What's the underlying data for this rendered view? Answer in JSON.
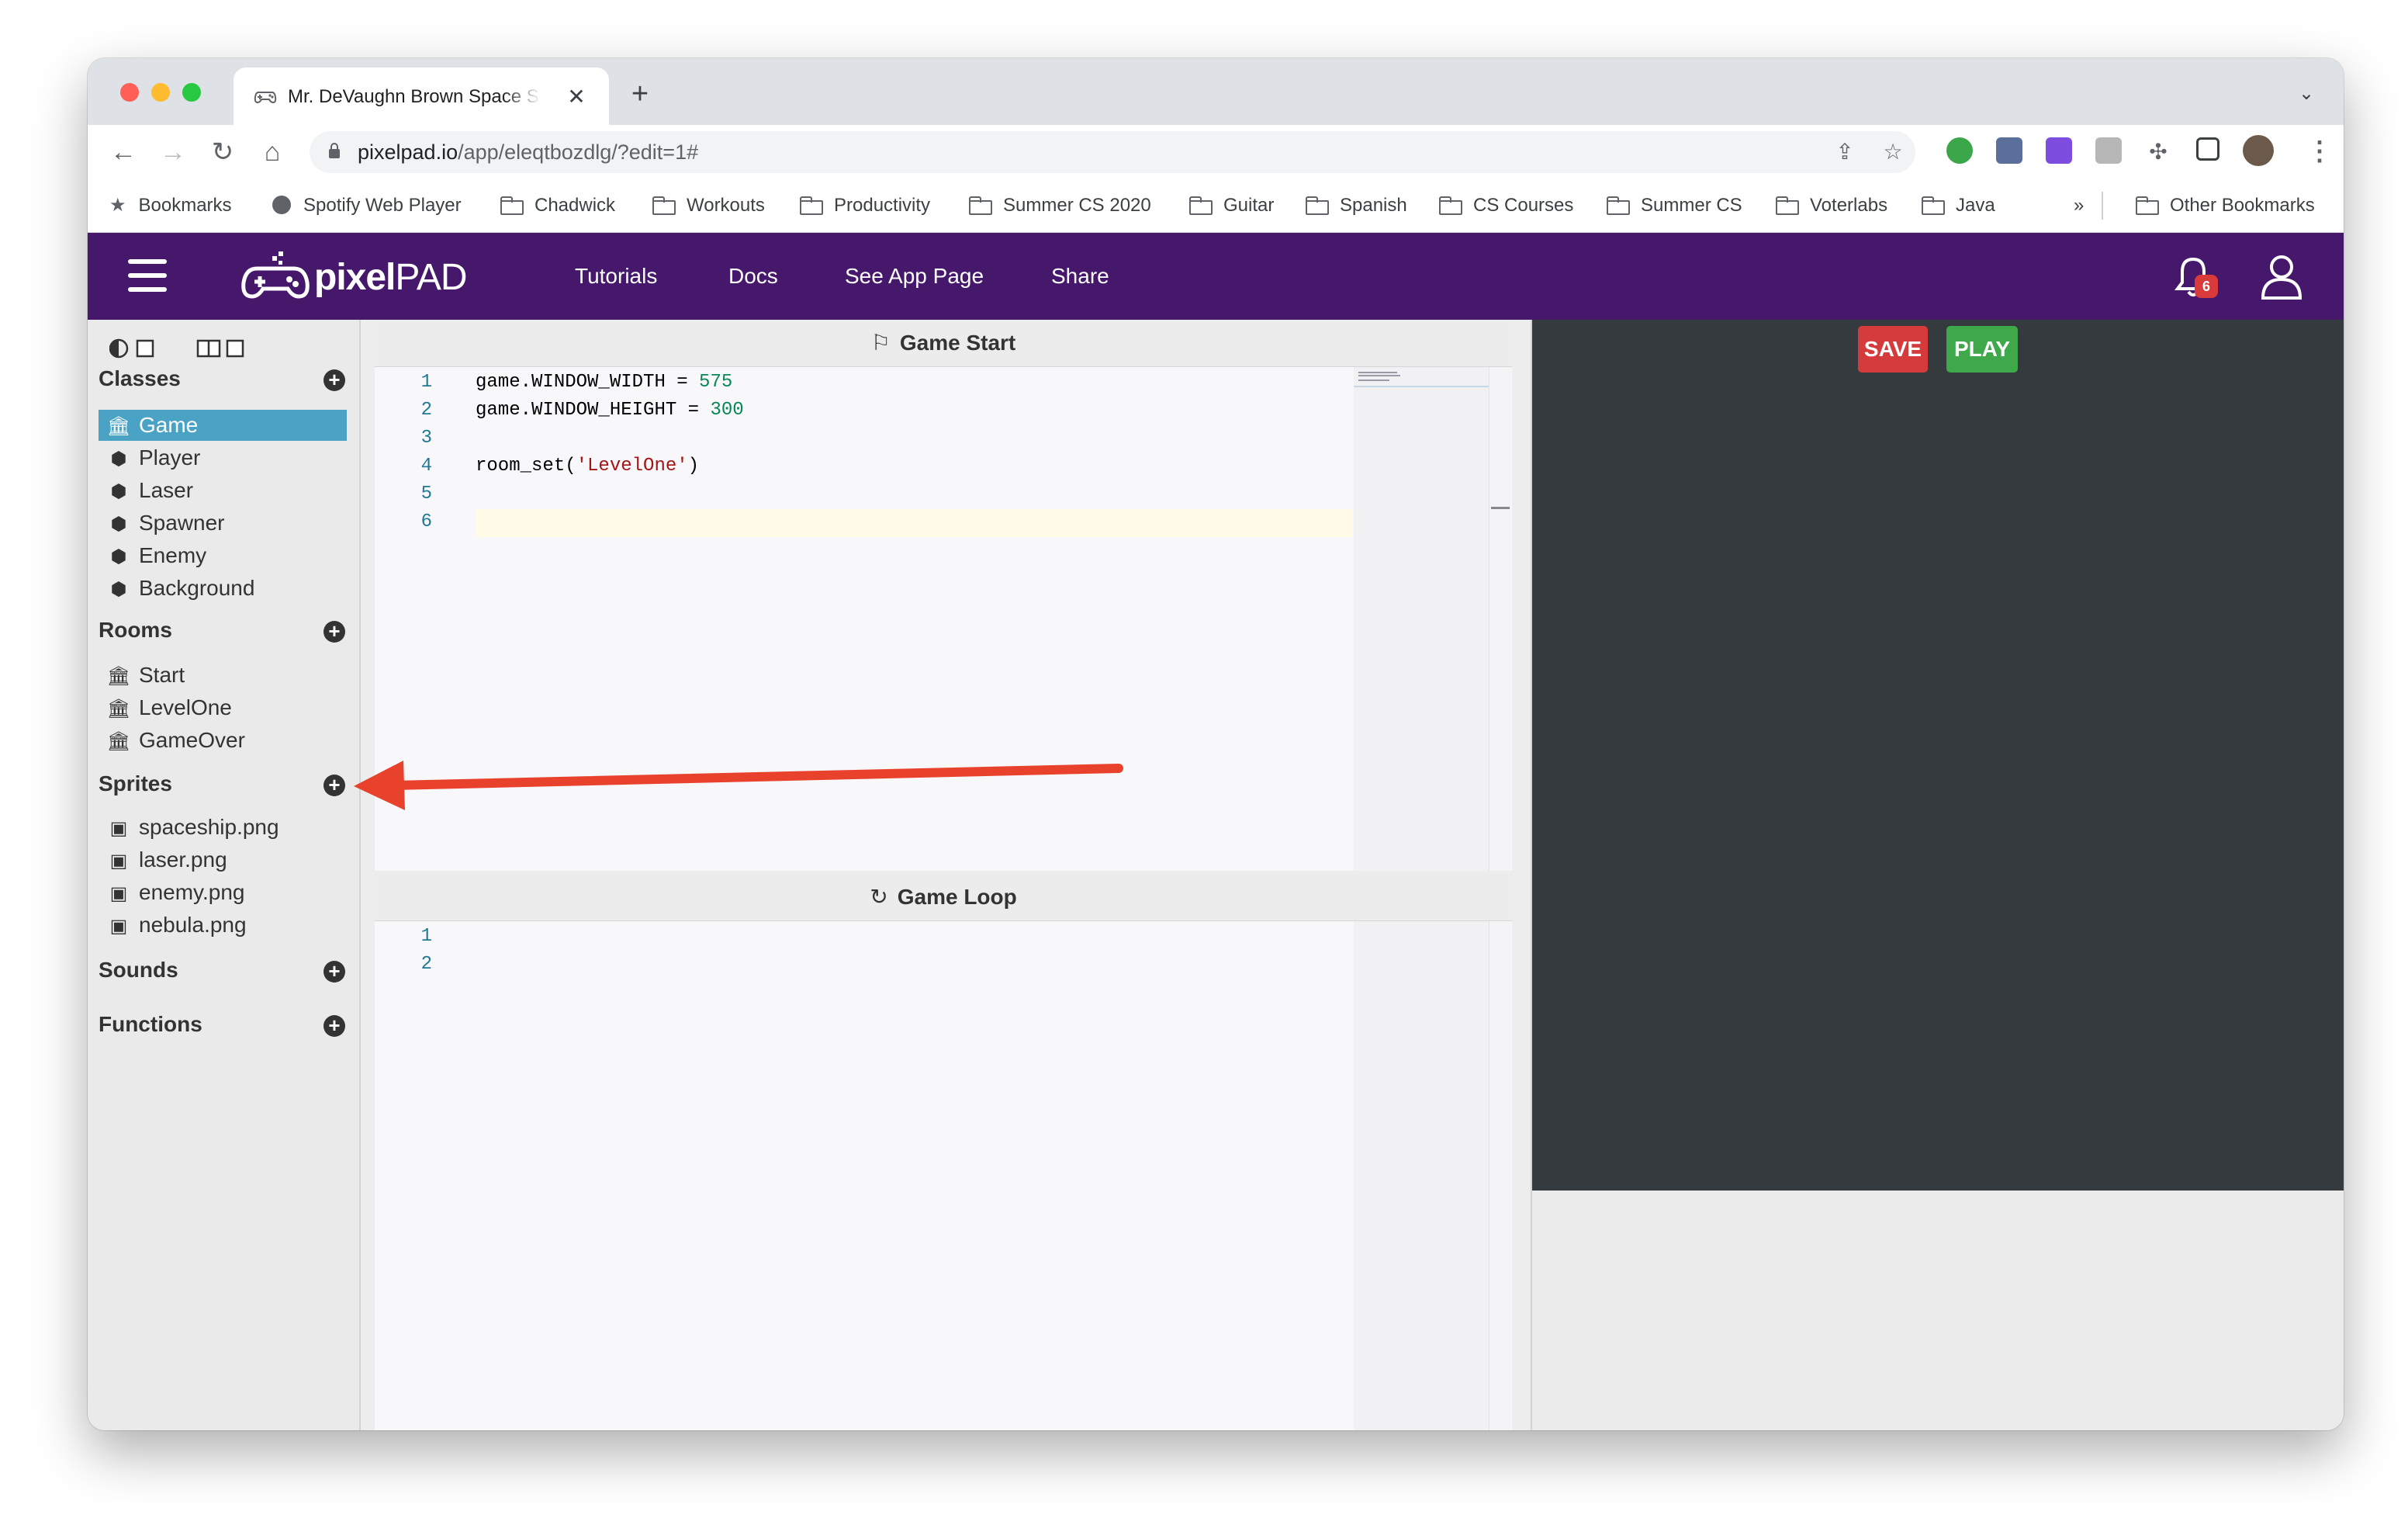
{
  "browser": {
    "tab_title": "Mr. DeVaughn Brown Space Shooter",
    "tab_close": "✕",
    "new_tab": "+",
    "url_host": "pixelpad.io",
    "url_path": "/app/eleqtbozdlg/?edit=1#",
    "bookmarks": [
      "Bookmarks",
      "Spotify Web Player",
      "Chadwick",
      "Workouts",
      "Productivity",
      "Summer CS 2020",
      "Guitar",
      "Spanish",
      "CS Courses",
      "Summer CS",
      "Voterlabs",
      "Java"
    ],
    "more_bookmarks": "»",
    "other_bookmarks": "Other Bookmarks"
  },
  "header": {
    "logo_main": "pixel",
    "logo_pad": "PAD",
    "nav": [
      "Tutorials",
      "Docs",
      "See App Page",
      "Share"
    ],
    "notifications": "6"
  },
  "sidebar": {
    "classes_title": "Classes",
    "classes": [
      "Game",
      "Player",
      "Laser",
      "Spawner",
      "Enemy",
      "Background"
    ],
    "rooms_title": "Rooms",
    "rooms": [
      "Start",
      "LevelOne",
      "GameOver"
    ],
    "sprites_title": "Sprites",
    "sprites": [
      "spaceship.png",
      "laser.png",
      "enemy.png",
      "nebula.png"
    ],
    "sounds_title": "Sounds",
    "functions_title": "Functions",
    "add_symbol": "+"
  },
  "editor": {
    "start_title": "Game Start",
    "start_line_numbers": [
      "1",
      "2",
      "3",
      "4",
      "5",
      "6"
    ],
    "start_code": {
      "l1_a": "game.WINDOW_WIDTH = ",
      "l1_b": "575",
      "l2_a": "game.WINDOW_HEIGHT = ",
      "l2_b": "300",
      "l4_a": "room_set(",
      "l4_b": "'LevelOne'",
      "l4_c": ")"
    },
    "loop_title": "Game Loop",
    "loop_line_numbers": [
      "1",
      "2"
    ]
  },
  "game_panel": {
    "save_label": "SAVE",
    "play_label": "PLAY"
  },
  "colors": {
    "header_bg": "#46186b",
    "active_item": "#4aa3c4",
    "save_btn": "#d63b3b",
    "play_btn": "#3ea84a",
    "game_area": "#353a3e",
    "annotation_arrow": "#e8412c"
  }
}
